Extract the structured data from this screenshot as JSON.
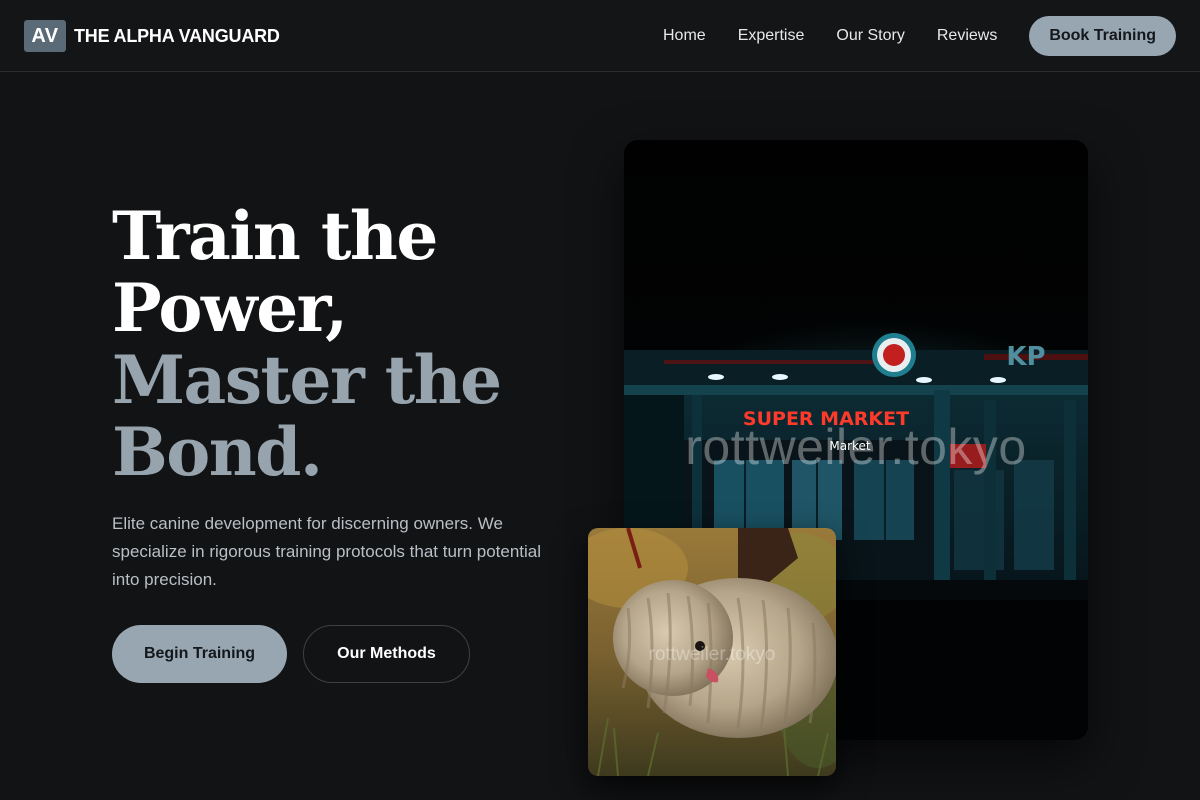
{
  "brand": {
    "logo_initials": "AV",
    "name": "THE ALPHA VANGUARD"
  },
  "nav": {
    "links": [
      "Home",
      "Expertise",
      "Our Story",
      "Reviews"
    ],
    "cta": "Book Training"
  },
  "hero": {
    "headline_lines": [
      "Train the",
      "Power,",
      "Master the",
      "Bond."
    ],
    "subtext": "Elite canine development for discerning owners. We specialize in rigorous training protocols that turn potential into precision.",
    "primary_button": "Begin Training",
    "secondary_button": "Our Methods"
  },
  "images": {
    "main_watermark": "rottweiler.tokyo",
    "main_sign_text": "SUPER MARKET",
    "main_sign_sub": "Market",
    "main_sign_corner": "KP",
    "inset_watermark": "rottweiler.tokyo"
  },
  "colors": {
    "background": "#121315",
    "accent": "#97a6b1",
    "muted_headline": "#97a4ae",
    "logo_box": "#5a6a76"
  }
}
